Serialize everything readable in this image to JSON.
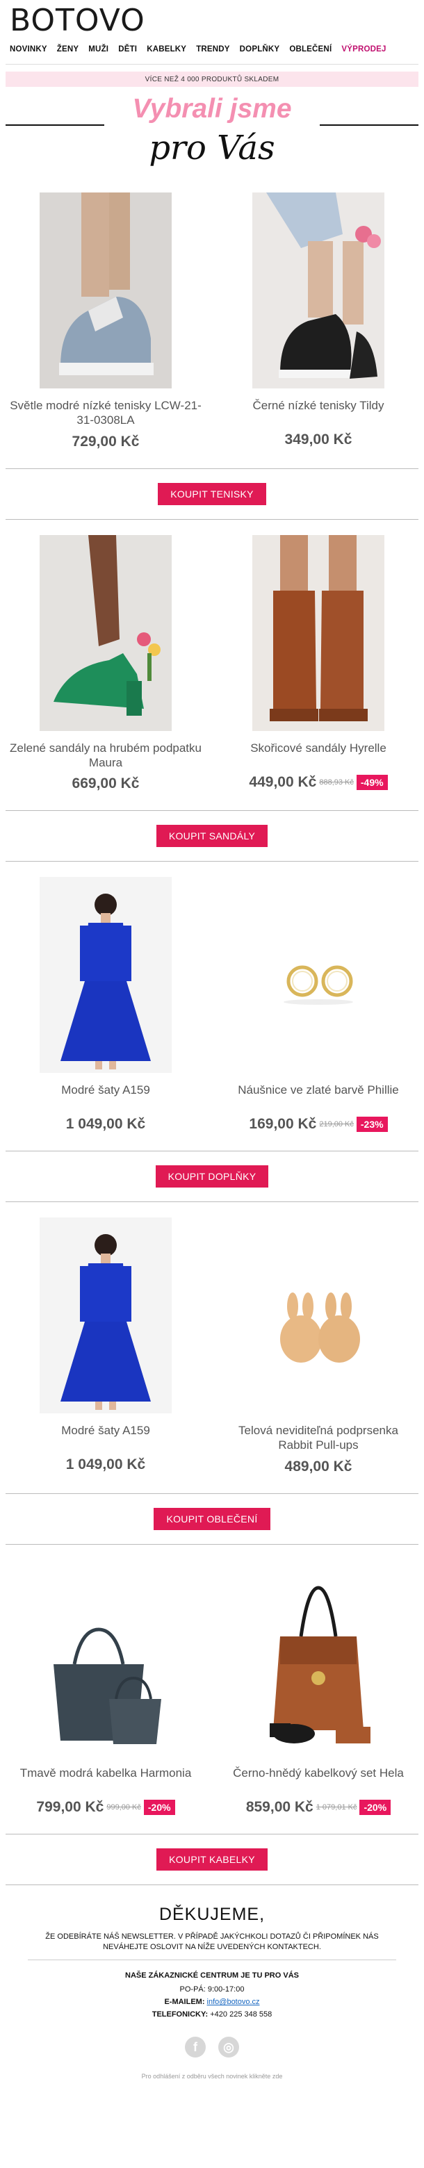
{
  "brand": {
    "logo": "BOTOVO"
  },
  "nav": [
    "NOVINKY",
    "ŽENY",
    "MUŽI",
    "DĚTI",
    "KABELKY",
    "TRENDY",
    "DOPLŇKY",
    "OBLEČENÍ",
    "VÝPRODEJ"
  ],
  "stock_bar": "VÍCE NEŽ 4 000 PRODUKTŮ SKLADEM",
  "hero": {
    "line1": "Vybrali jsme",
    "line2": "pro Vás"
  },
  "sections": [
    {
      "products": [
        {
          "name": "Světle modré nízké tenisky LCW-21-31-0308LA",
          "price": "729,00 Kč",
          "image": "light-blue-sneakers"
        },
        {
          "name": "Černé nízké tenisky Tildy",
          "price": "349,00 Kč",
          "image": "black-sneakers"
        }
      ],
      "button": "KOUPIT TENISKY"
    },
    {
      "products": [
        {
          "name": "Zelené sandály na hrubém podpatku Maura",
          "price": "669,00 Kč",
          "image": "green-sandals"
        },
        {
          "name": "Skořicové sandály Hyrelle",
          "price": "449,00 Kč",
          "old_price": "888,93 Kč",
          "discount": "-49%",
          "image": "cinnamon-sandals"
        }
      ],
      "button": "KOUPIT  SANDÁLY"
    },
    {
      "products": [
        {
          "name": "Modré šaty A159",
          "price": "1 049,00 Kč",
          "image": "blue-dress"
        },
        {
          "name": "Náušnice ve zlaté barvě Phillie",
          "price": "169,00 Kč",
          "old_price": "219,00 Kč",
          "discount": "-23%",
          "image": "gold-earrings"
        }
      ],
      "button": "KOUPIT DOPLŇKY"
    },
    {
      "products": [
        {
          "name": "Modré šaty A159",
          "price": "1 049,00 Kč",
          "image": "blue-dress"
        },
        {
          "name": "Telová neviditeľná podprsenka Rabbit Pull-ups",
          "price": "489,00 Kč",
          "image": "nude-bra"
        }
      ],
      "button": "KOUPIT OBLEČENÍ"
    },
    {
      "products": [
        {
          "name": "Tmavě modrá kabelka Harmonia",
          "price": "799,00 Kč",
          "old_price": "999,00 Kč",
          "discount": "-20%",
          "image": "navy-handbag"
        },
        {
          "name": "Černo-hnědý kabelkový set Hela",
          "price": "859,00 Kč",
          "old_price": "1 079,01 Kč",
          "discount": "-20%",
          "image": "brown-handbag-set"
        }
      ],
      "button": "KOUPIT KABELKY"
    }
  ],
  "footer": {
    "thanks": "DĚKUJEME,",
    "thanks_sub": "ŽE ODEBÍRÁTE NÁŠ NEWSLETTER. V PŘÍPADĚ JAKÝCHKOLI DOTAZŮ ČI PŘIPOMÍNEK NÁS NEVÁHEJTE OSLOVIT NA NÍŽE UVEDENÝCH KONTAKTECH.",
    "centrum": "NAŠE ZÁKAZNICKÉ CENTRUM JE TU PRO VÁS",
    "hours": "PO-PÁ: 9:00-17:00",
    "email_label": "E-MAILEM:",
    "email": "info@botovo.cz",
    "phone_label": "TELEFONICKY:",
    "phone": "+420 225 348 558",
    "unsub_text": "Pro odhlášení z odběru všech novinek klikněte",
    "unsub_link": "zde"
  },
  "colors": {
    "accent": "#e01a54",
    "hero_pink": "#f48fb1",
    "stock_bg": "#fce4ec",
    "sale_nav": "#c0106f"
  }
}
